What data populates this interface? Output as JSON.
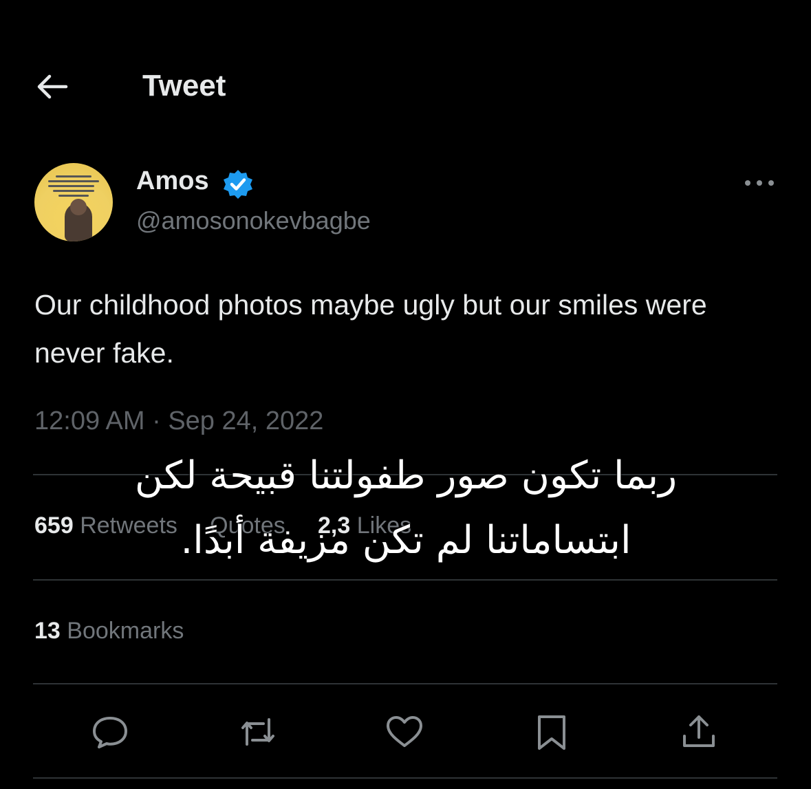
{
  "header": {
    "back_icon": "arrow-left-icon",
    "title": "Tweet"
  },
  "author": {
    "name": "Amos",
    "handle": "@amosonokevbagbe",
    "verified_color": "#1d9bf0",
    "more_icon": "more-horizontal-icon"
  },
  "tweet": {
    "text": "Our childhood photos maybe ugly but our smiles were never fake.",
    "timestamp": "12:09 AM · Sep 24, 2022"
  },
  "stats": {
    "retweets_count": "659",
    "retweets_label": "Retweets",
    "quotes_label": "Quotes",
    "likes_count": "2,3",
    "likes_label": "Likes"
  },
  "bookmarks": {
    "count": "13",
    "label": "Bookmarks"
  },
  "actions": [
    {
      "icon": "reply-icon"
    },
    {
      "icon": "retweet-icon"
    },
    {
      "icon": "like-icon"
    },
    {
      "icon": "bookmark-icon"
    },
    {
      "icon": "share-icon"
    }
  ],
  "overlay": {
    "line1": "ربما تكون صور طفولتنا قبيحة لكن",
    "line2": "ابتساماتنا لم تكن مزيفة أبدًا."
  },
  "colors": {
    "background": "#000000",
    "text": "#e7e9ea",
    "secondary": "#71767b",
    "divider": "#2f3336"
  }
}
